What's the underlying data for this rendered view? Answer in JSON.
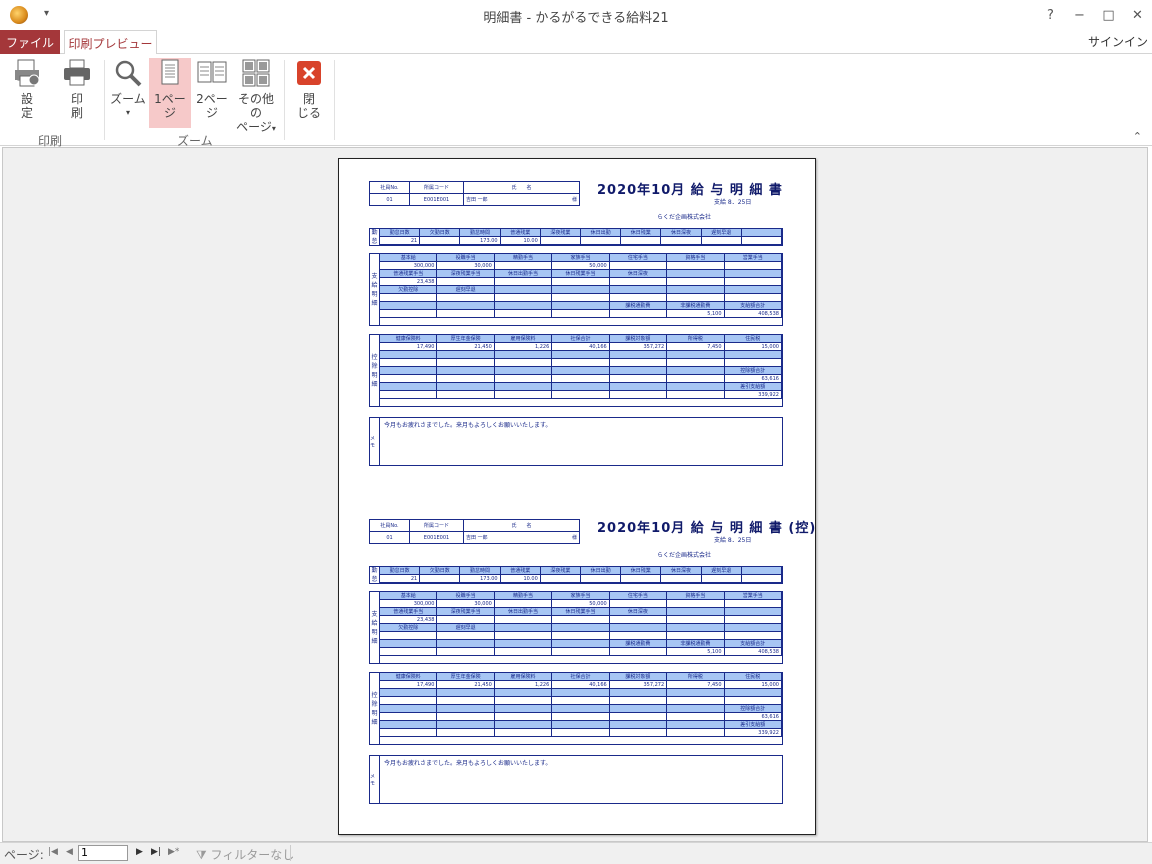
{
  "window": {
    "title": "明細書 - かるがるできる給料21",
    "help": "?",
    "minimize": "−",
    "maximize": "□",
    "close": "✕"
  },
  "tabs": {
    "file": "ファイル",
    "preview": "印刷プレビュー",
    "signin": "サインイン"
  },
  "ribbon": {
    "settings": [
      "設",
      "定"
    ],
    "print": [
      "印",
      "刷"
    ],
    "zoom": "ズーム",
    "one_page": [
      "1ペー",
      "ジ"
    ],
    "two_page": [
      "2ペー",
      "ジ"
    ],
    "other_pages": [
      "その他の",
      "ページ"
    ],
    "close": [
      "閉",
      "じる"
    ],
    "group_print": "印刷",
    "group_zoom": "ズーム"
  },
  "slip": {
    "header_labels": [
      "社員No.",
      "所属コード",
      "氏　　名"
    ],
    "header_values": [
      "01",
      "E001E001",
      "吉田 一郎",
      "様"
    ],
    "title": "2020年10月 給 与 明 細 書",
    "title_copy": "2020年10月 給 与 明 細 書 (控)",
    "pay_date": "支給 8．25日",
    "company": "らくだ企画株式会社",
    "attendance_side": [
      "勤",
      "怠"
    ],
    "attendance_labels": [
      "勤怠日数",
      "欠勤日数",
      "勤怠時間",
      "普通残業",
      "深夜残業",
      "休日出勤",
      "休日残業",
      "休日深夜",
      "遅刻早退",
      ""
    ],
    "attendance_values": [
      "21",
      "",
      "173.00",
      "10.00",
      "",
      "",
      "",
      "",
      "",
      ""
    ],
    "pay_side": [
      "支",
      "給",
      "明",
      "細"
    ],
    "pay_rows": [
      [
        "基本給",
        "役職手当",
        "精勤手当",
        "家族手当",
        "住宅手当",
        "資格手当",
        "営業手当"
      ],
      [
        "300,000",
        "30,000",
        "",
        "50,000",
        "",
        "",
        ""
      ],
      [
        "普通残業手当",
        "深夜残業手当",
        "休日出勤手当",
        "休日残業手当",
        "休日深夜",
        "",
        ""
      ],
      [
        "23,438",
        "",
        "",
        "",
        "",
        "",
        ""
      ],
      [
        "欠勤控除",
        "遅刻早退",
        "",
        "",
        "",
        "",
        ""
      ],
      [
        "",
        "",
        "",
        "",
        "",
        "",
        ""
      ],
      [
        "",
        "",
        "",
        "",
        "課税通勤費",
        "非課税通勤費",
        "支給額合計"
      ],
      [
        "",
        "",
        "",
        "",
        "",
        "5,100",
        "408,538"
      ]
    ],
    "ded_side": [
      "控",
      "除",
      "明",
      "細"
    ],
    "ded_rows": [
      [
        "健康保険料",
        "厚生年金保険",
        "雇用保険料",
        "社保合計",
        "課税対象額",
        "所得税",
        "住民税"
      ],
      [
        "17,490",
        "21,450",
        "1,226",
        "40,166",
        "357,272",
        "7,450",
        "15,000"
      ],
      [
        "",
        "",
        "",
        "",
        "",
        "",
        ""
      ],
      [
        "",
        "",
        "",
        "",
        "",
        "",
        ""
      ],
      [
        "",
        "",
        "",
        "",
        "",
        "",
        "控除額合計"
      ],
      [
        "",
        "",
        "",
        "",
        "",
        "",
        "63,616"
      ],
      [
        "",
        "",
        "",
        "",
        "",
        "",
        "差引支給額"
      ],
      [
        "",
        "",
        "",
        "",
        "",
        "",
        "339,922"
      ]
    ],
    "memo_side": "メモ",
    "memo_text": "今月もお疲れさまでした。来月もよろしくお願いいたします。"
  },
  "status": {
    "page_label": "ページ:",
    "page_value": "1",
    "filter": "フィルターなし"
  }
}
